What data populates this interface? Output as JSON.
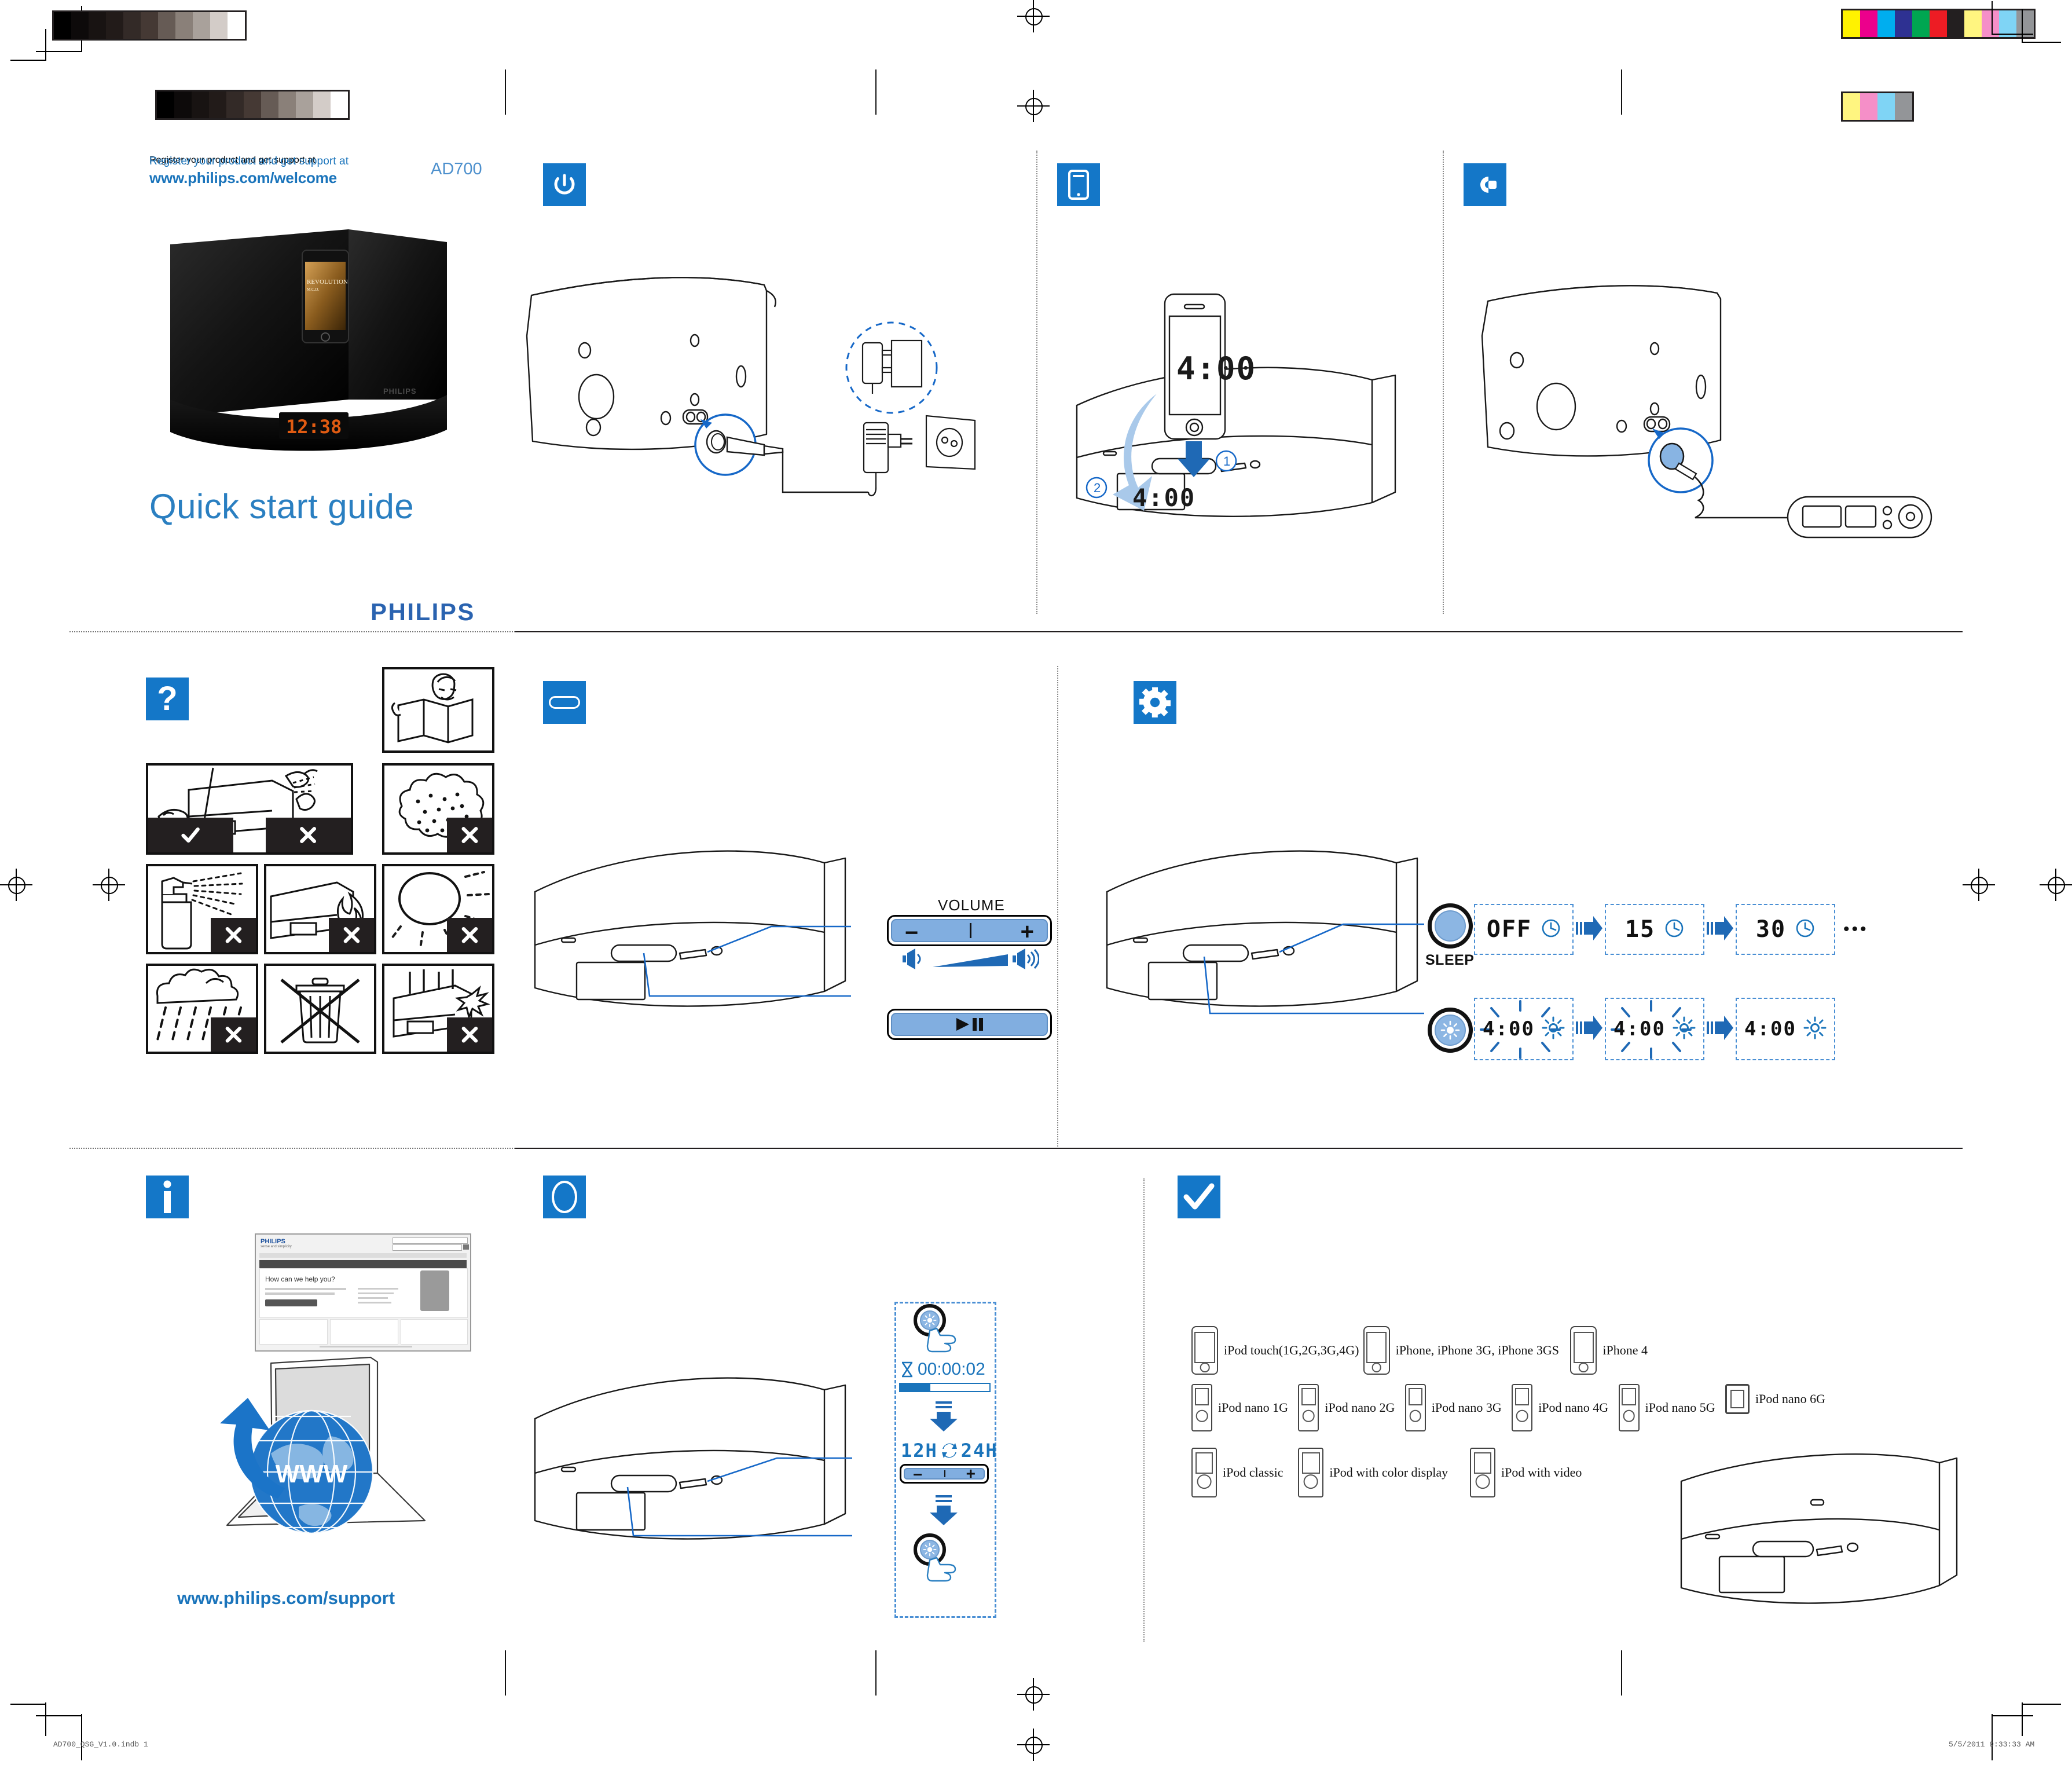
{
  "header": {
    "register_line": "Register your product and get support at",
    "register_url": "www.philips.com/welcome",
    "model": "AD700",
    "title": "Quick start guide",
    "brand": "PHILIPS"
  },
  "sections": {
    "power": {
      "icon": "power-icon"
    },
    "dock": {
      "icon": "phone-dock-icon",
      "step1": "1",
      "step2": "2",
      "phone_display": "4:00",
      "unit_display": "4:00"
    },
    "remote": {
      "icon": "remote-plug-icon"
    },
    "safety": {
      "icon": "question-icon"
    },
    "controls": {
      "icon": "button-bar-icon"
    },
    "settings": {
      "icon": "gear-icon"
    },
    "info": {
      "icon": "info-icon",
      "support_url": "www.philips.com/support",
      "site_title": "How can we help you?",
      "site_brand": "PHILIPS",
      "site_tagline": "sense and simplicity",
      "globe_label": "WWW"
    },
    "clock": {
      "icon": "circle-icon"
    },
    "compat": {
      "icon": "check-icon"
    }
  },
  "controls": {
    "volume_label": "VOLUME",
    "minus": "−",
    "plus": "+",
    "play_pause": "▶❙❙"
  },
  "sleep": {
    "button_label": "SLEEP",
    "steps": [
      "OFF",
      "15",
      "30"
    ],
    "ellipsis": "•••"
  },
  "brightness": {
    "steps": [
      "4:00",
      "4:00",
      "4:00"
    ]
  },
  "clock_setup": {
    "hold_time": "00:00:02",
    "format_a": "12H",
    "format_b": "24H",
    "minus": "−",
    "plus": "+"
  },
  "safety_icons": [
    {
      "name": "man-reading-manual",
      "mark": "none"
    },
    {
      "name": "wipe-with-cloth",
      "mark": "check-left"
    },
    {
      "name": "no-spray-on-device",
      "mark": "cross"
    },
    {
      "name": "no-dust",
      "mark": "cross"
    },
    {
      "name": "no-liquid-spray",
      "mark": "cross"
    },
    {
      "name": "no-fire",
      "mark": "cross"
    },
    {
      "name": "no-direct-sunlight",
      "mark": "cross"
    },
    {
      "name": "no-rain",
      "mark": "cross"
    },
    {
      "name": "do-not-throw-in-trash",
      "mark": "none"
    },
    {
      "name": "no-lightning",
      "mark": "cross"
    }
  ],
  "compatibility": {
    "rows": [
      [
        {
          "label": "iPod touch(1G,2G,3G,4G)",
          "device": "phone"
        },
        {
          "label": "iPhone, iPhone 3G, iPhone 3GS",
          "device": "phone"
        },
        {
          "label": "iPhone 4",
          "device": "phone"
        }
      ],
      [
        {
          "label": "iPod nano 1G",
          "device": "nano"
        },
        {
          "label": "iPod nano 2G",
          "device": "nano"
        },
        {
          "label": "iPod nano 3G",
          "device": "nano"
        },
        {
          "label": "iPod nano 4G",
          "device": "nano"
        },
        {
          "label": "iPod nano 5G",
          "device": "nano"
        },
        {
          "label": "iPod nano 6G",
          "device": "nano-square"
        }
      ],
      [
        {
          "label": "iPod classic",
          "device": "classic"
        },
        {
          "label": "iPod with color display",
          "device": "classic"
        },
        {
          "label": "iPod with video",
          "device": "classic"
        }
      ]
    ]
  },
  "footer": {
    "file": "AD700_QSG_V1.0.indb    1",
    "date": "5/5/2011    9:33:33 AM"
  },
  "colors": {
    "brand_blue": "#1477c8",
    "link_blue": "#1a74bb",
    "button_fill": "#81aee0",
    "arrow_blue": "#2f6fb5",
    "dash_blue": "#4a8fd4",
    "grayscale_bar": [
      "#000000",
      "#0d0a0a",
      "#181312",
      "#221b19",
      "#332a27",
      "#453934",
      "#665b55",
      "#8a8079",
      "#a9a19b",
      "#d3ccc8",
      "#ffffff"
    ],
    "color_bar_top": [
      "#fff200",
      "#ec008c",
      "#00aeef",
      "#2e3192",
      "#00a651",
      "#ed1c24",
      "#231f20",
      "#fff580",
      "#f58fc8",
      "#7fd4f5",
      "#939598"
    ],
    "color_bar_small": [
      "#fff580",
      "#f58fc8",
      "#7fd4f5",
      "#939598"
    ]
  }
}
